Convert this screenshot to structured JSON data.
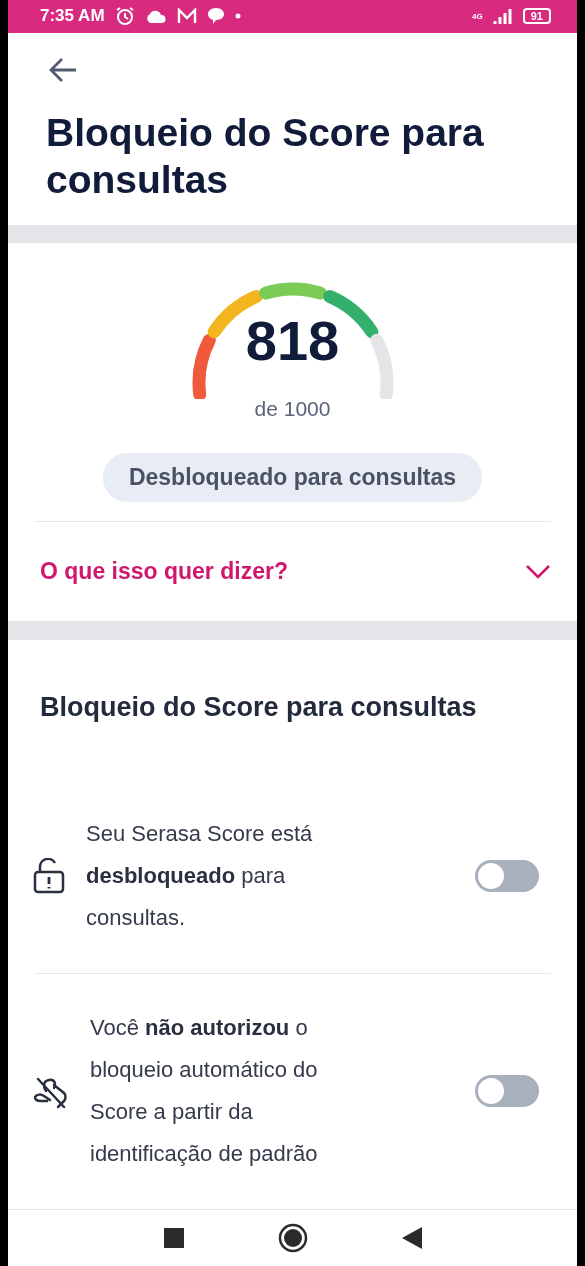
{
  "status_bar": {
    "time": "7:35 AM",
    "network": "4G",
    "battery": "91"
  },
  "header": {
    "title": "Bloqueio do Score para consultas"
  },
  "score": {
    "value": "818",
    "scale": "de 1000",
    "status": "Desbloqueado para consultas"
  },
  "explainer": {
    "label": "O que isso quer dizer?",
    "expanded": false
  },
  "section": {
    "title": "Bloqueio do Score para consultas",
    "items": [
      {
        "kind": "unlocked",
        "text": "Seu Serasa Score está **desbloqueado** para consultas.",
        "on": false
      },
      {
        "kind": "auto",
        "text": "Você **não autorizou** o bloqueio automático do Score a partir da identificação de padrão",
        "on": false
      }
    ]
  }
}
